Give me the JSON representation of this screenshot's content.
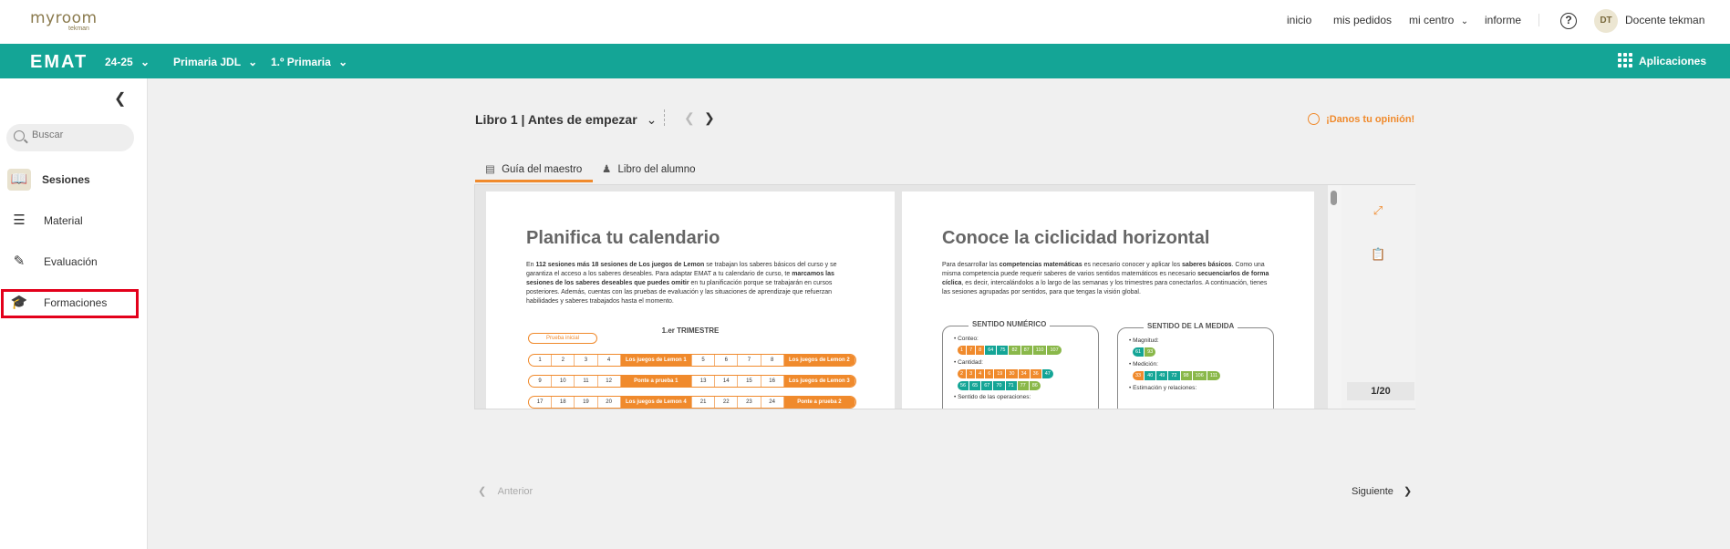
{
  "topbar": {
    "logo_main": "myroom",
    "logo_sub": "tekman",
    "nav": [
      "inicio",
      "mis pedidos",
      "mi centro",
      "informe"
    ],
    "help_glyph": "?",
    "avatar_initials": "DT",
    "user_name": "Docente tekman"
  },
  "greenbar": {
    "brand": "EMAT",
    "selects": [
      "24-25",
      "Primaria JDL",
      "1.º Primaria"
    ],
    "apps_label": "Aplicaciones",
    "color": "#14a596"
  },
  "sidebar": {
    "search_placeholder": "Buscar",
    "items": [
      {
        "label": "Sesiones",
        "icon": "book-icon"
      },
      {
        "label": "Material",
        "icon": "stack-icon"
      },
      {
        "label": "Evaluación",
        "icon": "pencil-icon"
      },
      {
        "label": "Formaciones",
        "icon": "graduation-cap-icon"
      }
    ]
  },
  "main": {
    "book_title": "Libro 1 | Antes de empezar",
    "feedback": "¡Danos tu opinión!",
    "tabs": [
      "Guía del maestro",
      "Libro del alumno"
    ],
    "page_indicator": "1/20",
    "prev": "Anterior",
    "next": "Siguiente"
  },
  "doc": {
    "left": {
      "title": "Planifica tu calendario",
      "para_html": "En <b>112 sesiones más 18 sesiones de Los juegos de Lemon</b> se trabajan los saberes básicos del curso y se garantiza el acceso a los saberes deseables. Para adaptar EMAT a tu calendario de curso, te <b>marcamos las sesiones de los saberes deseables que puedes omitir</b> en tu planificación porque se trabajarán en cursos posteriores. Además, cuentas con las pruebas de evaluación y las situaciones de aprendizaje que refuerzan habilidades y saberes trabajados hasta el momento.",
      "prueba_inicial": "Prueba inicial",
      "trimestre": "1.er TRIMESTRE",
      "rows": [
        [
          "1",
          "2",
          "3",
          "4",
          "Los juegos de Lemon 1",
          "5",
          "6",
          "7",
          "8",
          "Los juegos de Lemon 2"
        ],
        [
          "9",
          "10",
          "11",
          "12",
          "Ponte a prueba 1",
          "13",
          "14",
          "15",
          "16",
          "Los juegos de Lemon 3"
        ],
        [
          "17",
          "18",
          "19",
          "20",
          "Los juegos de Lemon 4",
          "21",
          "22",
          "23",
          "24",
          "Ponte a prueba 2"
        ]
      ]
    },
    "right": {
      "title": "Conoce la ciclicidad horizontal",
      "para_html": "Para desarrollar las <b>competencias matemáticas</b> es necesario conocer y aplicar los <b>saberes básicos</b>. Como una misma competencia puede requerir saberes de varios sentidos matemáticos es necesario <b>secuenciarlos de forma cíclica</b>, es decir, intercalándolos a lo largo de las semanas y los trimestres para conectarlos. A continuación, tienes las sesiones agrupadas por sentidos, para que tengas la visión global.",
      "box1": {
        "title": "SENTIDO NUMÉRICO",
        "conteo": "Conteo:",
        "conteo_chips": [
          [
            "1",
            "o"
          ],
          [
            "7",
            "o"
          ],
          [
            "8",
            "o"
          ],
          [
            "64",
            "t"
          ],
          [
            "75",
            "t"
          ],
          [
            "82",
            "g"
          ],
          [
            "87",
            "g"
          ],
          [
            "110",
            "g"
          ],
          [
            "107",
            "g"
          ]
        ],
        "cantidad": "Cantidad:",
        "cantidad_chips1": [
          [
            "2",
            "o"
          ],
          [
            "3",
            "o"
          ],
          [
            "4",
            "o"
          ],
          [
            "6",
            "o"
          ],
          [
            "19",
            "o"
          ],
          [
            "30",
            "o"
          ],
          [
            "34",
            "o"
          ],
          [
            "36",
            "o"
          ],
          [
            "47",
            "t"
          ]
        ],
        "cantidad_chips2": [
          [
            "56",
            "t"
          ],
          [
            "65",
            "t"
          ],
          [
            "67",
            "t"
          ],
          [
            "70",
            "t"
          ],
          [
            "71",
            "t"
          ],
          [
            "77",
            "g"
          ],
          [
            "86",
            "g"
          ]
        ],
        "cut": "Sentido de las operaciones:"
      },
      "box2": {
        "title": "SENTIDO DE LA MEDIDA",
        "magnitud": "Magnitud:",
        "magnitud_chips": [
          [
            "61",
            "t"
          ],
          [
            "93",
            "g"
          ]
        ],
        "medicion": "Medición:",
        "medicion_chips": [
          [
            "33",
            "o"
          ],
          [
            "40",
            "t"
          ],
          [
            "49",
            "t"
          ],
          [
            "72",
            "t"
          ],
          [
            "98",
            "g"
          ],
          [
            "106",
            "g"
          ],
          [
            "111",
            "g"
          ]
        ],
        "estimacion": "Estimación y relaciones:"
      }
    }
  }
}
